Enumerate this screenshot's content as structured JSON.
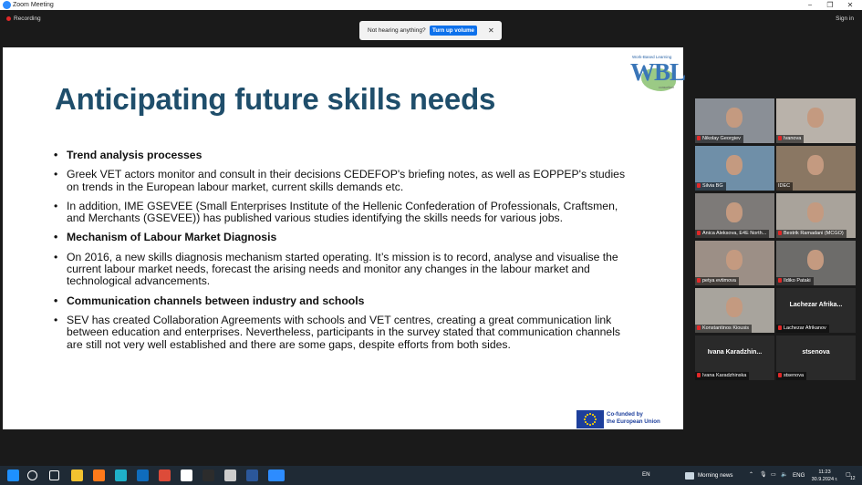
{
  "window": {
    "title": "Zoom Meeting",
    "controls": {
      "minimize": "−",
      "maximize": "❐",
      "close": "✕"
    }
  },
  "meeting_bar": {
    "recording_label": "Recording",
    "sign_in": "Sign in",
    "toast": {
      "message": "Not hearing anything?",
      "button": "Turn up volume",
      "close": "✕"
    }
  },
  "slide": {
    "logo": {
      "small": "Work-Based Learning",
      "big": "WBL",
      "sub": "consortium"
    },
    "title": "Anticipating future skills needs",
    "bullets": [
      {
        "text": "Trend analysis processes",
        "bold": true
      },
      {
        "text": "Greek VET actors monitor and consult in their decisions CEDEFOP's briefing notes, as well as EOPPEP's studies on trends in the European labour market, current skills demands etc.",
        "bold": false
      },
      {
        "text": "In addition, IME GSEVEE (Small Enterprises Institute of the Hellenic Confederation of Professionals, Craftsmen, and Merchants (GSEVEE)) has published various studies identifying the skills needs for various jobs.",
        "bold": false
      },
      {
        "text": "Mechanism of Labour Market Diagnosis",
        "bold": true
      },
      {
        "text": "On 2016, a new skills diagnosis mechanism started operating. It’s mission is to record, analyse and visualise the current labour market needs, forecast the arising needs and monitor any changes in the labour market and technological advancements.",
        "bold": false
      },
      {
        "text": "Communication channels between industry and schools",
        "bold": true
      },
      {
        "text": "SEV has created Collaboration Agreements with schools and VET centres, creating a great communication link between education and enterprises. Nevertheless, participants in the survey stated that communication channels are still not very well established and there are some gaps, despite efforts from both sides.",
        "bold": false
      }
    ],
    "eu_label_1": "Co-funded by",
    "eu_label_2": "the European Union"
  },
  "participants": [
    {
      "name": "Nikolay Georgiev",
      "video": true,
      "muted": true,
      "active": false,
      "bg": "#8a8f96"
    },
    {
      "name": "Ivanova",
      "video": true,
      "muted": true,
      "active": false,
      "bg": "#b9b2aa"
    },
    {
      "name": "Silvia BG",
      "video": true,
      "muted": true,
      "active": false,
      "bg": "#6f8fa8"
    },
    {
      "name": "IDEC",
      "video": true,
      "muted": false,
      "active": true,
      "bg": "#8a7763"
    },
    {
      "name": "Anica Aleksova, E4E North...",
      "video": true,
      "muted": true,
      "active": false,
      "bg": "#7d7a78"
    },
    {
      "name": "Bestrik Ramadani (MCGO)",
      "video": true,
      "muted": true,
      "active": false,
      "bg": "#a9a39b"
    },
    {
      "name": "petya evtimova",
      "video": true,
      "muted": true,
      "active": false,
      "bg": "#9c8f86"
    },
    {
      "name": "Ildiko Pataki",
      "video": true,
      "muted": true,
      "active": false,
      "bg": "#6d6c6a"
    },
    {
      "name": "Konstantinos Kiousis",
      "video": true,
      "muted": true,
      "active": false,
      "bg": "#a8a49d"
    },
    {
      "name": "Lachezar Afrikanov",
      "video": false,
      "muted": true,
      "active": false,
      "display": "Lachezar  Afrika..."
    },
    {
      "name": "Ivana Karadzhinska",
      "video": false,
      "muted": true,
      "active": false,
      "display": "Ivana  Karadzhin..."
    },
    {
      "name": "stsenova",
      "video": false,
      "muted": true,
      "active": false,
      "display": "stsenova"
    }
  ],
  "taskbar": {
    "language": "EN",
    "weather": "Morning news",
    "input_lang": "ENG",
    "time": "11:23",
    "date": "30.9.2024 г.",
    "notification_count": "12",
    "apps": [
      {
        "icon": "windows-start-icon",
        "color": "#1e90ff"
      },
      {
        "icon": "search-icon",
        "color": "#ffffff"
      },
      {
        "icon": "task-view-icon",
        "color": "#ffffff"
      },
      {
        "icon": "file-explorer-icon",
        "color": "#f2c230"
      },
      {
        "icon": "firefox-icon",
        "color": "#ff7a1a"
      },
      {
        "icon": "edge-icon",
        "color": "#1fb0c9"
      },
      {
        "icon": "outlook-icon",
        "color": "#0f6cbd"
      },
      {
        "icon": "chrome-icon",
        "color": "#dd4b39"
      },
      {
        "icon": "app-r-icon",
        "color": "#ffffff"
      },
      {
        "icon": "app-dark-icon",
        "color": "#2c2c2c"
      },
      {
        "icon": "app-cloud-icon",
        "color": "#cccccc"
      },
      {
        "icon": "word-icon",
        "color": "#2b579a"
      },
      {
        "icon": "zoom-icon",
        "color": "#2d8cff"
      }
    ]
  }
}
